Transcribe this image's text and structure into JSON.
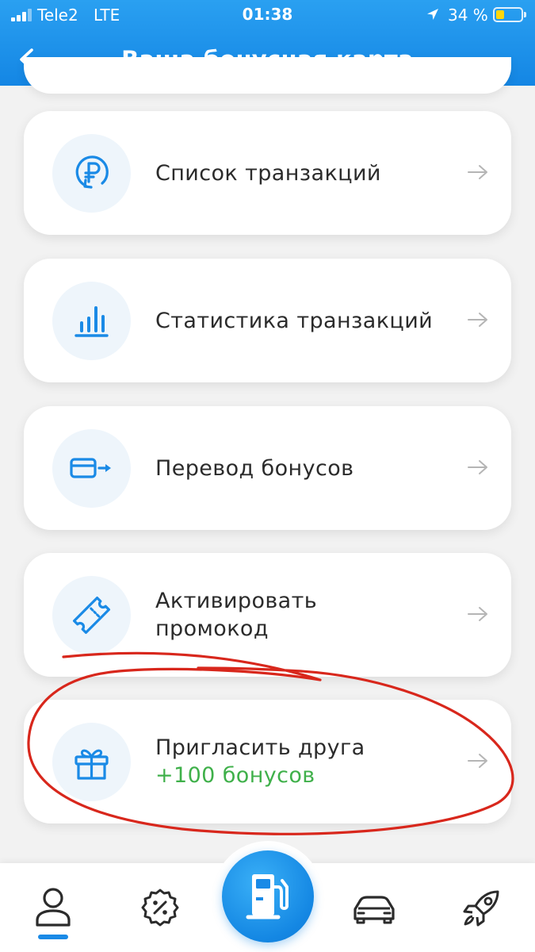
{
  "status_bar": {
    "carrier": "Tele2",
    "network": "LTE",
    "time": "01:38",
    "battery_percent": "34 %",
    "battery_level": 0.34,
    "location_icon": "location-arrow-icon"
  },
  "header": {
    "title": "Ваша бонусная карта",
    "back_icon": "arrow-left-icon"
  },
  "menu": {
    "items": [
      {
        "label": "Список транзакций",
        "icon": "ruble-cycle-icon"
      },
      {
        "label": "Статистика транзакций",
        "icon": "bar-chart-icon"
      },
      {
        "label": "Перевод бонусов",
        "icon": "card-transfer-icon"
      },
      {
        "label_line1": "Активировать",
        "label_line2": "промокод",
        "icon": "ticket-icon"
      },
      {
        "label": "Пригласить друга",
        "sublabel": "+100 бонусов",
        "icon": "gift-icon"
      }
    ],
    "arrow_icon": "arrow-right-icon"
  },
  "tabbar": {
    "tabs": [
      "profile-icon",
      "discount-badge-icon",
      "fuel-pump-icon",
      "car-icon",
      "rocket-icon"
    ],
    "active_tab": "profile-icon"
  },
  "colors": {
    "header_blue": "#1a8ae6",
    "accent_blue": "#1a8ae6",
    "bonus_green": "#3fb04a",
    "annotation_red": "#d8271c"
  }
}
